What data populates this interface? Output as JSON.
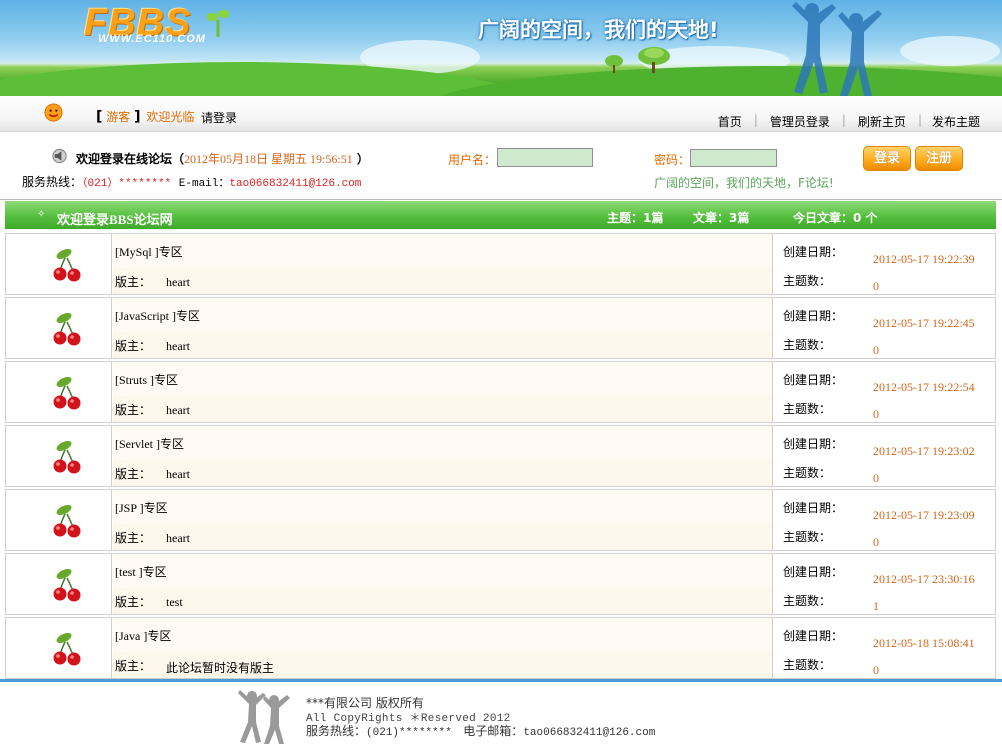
{
  "banner": {
    "logo": "FBBS",
    "logo_url": "WWW.EC110.COM",
    "slogan": "广阔的空间，我们的天地!"
  },
  "nav": {
    "guest_label": "游客",
    "welcome": "欢迎光临",
    "login_link": "请登录",
    "links": [
      "首页",
      "管理员登录",
      "刷新主页",
      "发布主题"
    ]
  },
  "login": {
    "welcome_text": "欢迎登录在线论坛",
    "datetime": "2012年05月18日 星期五 19:56:51",
    "hotline_label": "服务热线：",
    "hotline_number": "（021）********",
    "email_label": "E-mail：",
    "email": "tao066832411@126.com",
    "username_label": "用户名：",
    "username_value": "",
    "password_label": "密码：",
    "password_value": "",
    "slogan": "广阔的空间，我们的天地，F论坛!",
    "login_button": "登录",
    "register_button": "注册"
  },
  "forum": {
    "header_title": "欢迎登录BBS论坛网",
    "topics": "主题：1篇",
    "articles": "文章：3篇",
    "today": "今日文章：0 个",
    "date_label": "创建日期：",
    "count_label": "主题数：",
    "moderator_label": "版主：",
    "boards": [
      {
        "name": "[MySql ]专区",
        "moderator": "heart",
        "created": "2012-05-17 19:22:39",
        "topics": "0"
      },
      {
        "name": "[JavaScript ]专区",
        "moderator": "heart",
        "created": "2012-05-17 19:22:45",
        "topics": "0"
      },
      {
        "name": "[Struts ]专区",
        "moderator": "heart",
        "created": "2012-05-17 19:22:54",
        "topics": "0"
      },
      {
        "name": "[Servlet ]专区",
        "moderator": "heart",
        "created": "2012-05-17 19:23:02",
        "topics": "0"
      },
      {
        "name": "[JSP ]专区",
        "moderator": "heart",
        "created": "2012-05-17 19:23:09",
        "topics": "0"
      },
      {
        "name": "[test ]专区",
        "moderator": "test",
        "created": "2012-05-17 23:30:16",
        "topics": "1"
      },
      {
        "name": "[Java ]专区",
        "moderator": "此论坛暂时没有版主",
        "created": "2012-05-18 15:08:41",
        "topics": "0"
      }
    ]
  },
  "footer": {
    "company": "***有限公司 版权所有",
    "rights": "All CopyRights ＊Reserved 2012",
    "hotline_label": "服务热线：",
    "hotline": "(021)********",
    "email_label": "电子邮箱：",
    "email": "tao066832411@126.com"
  },
  "colors": {
    "accent_orange": "#e06a00",
    "date_orange": "#d4641b",
    "header_green": "#55bf3e",
    "footer_blue": "#4a9ad6"
  }
}
